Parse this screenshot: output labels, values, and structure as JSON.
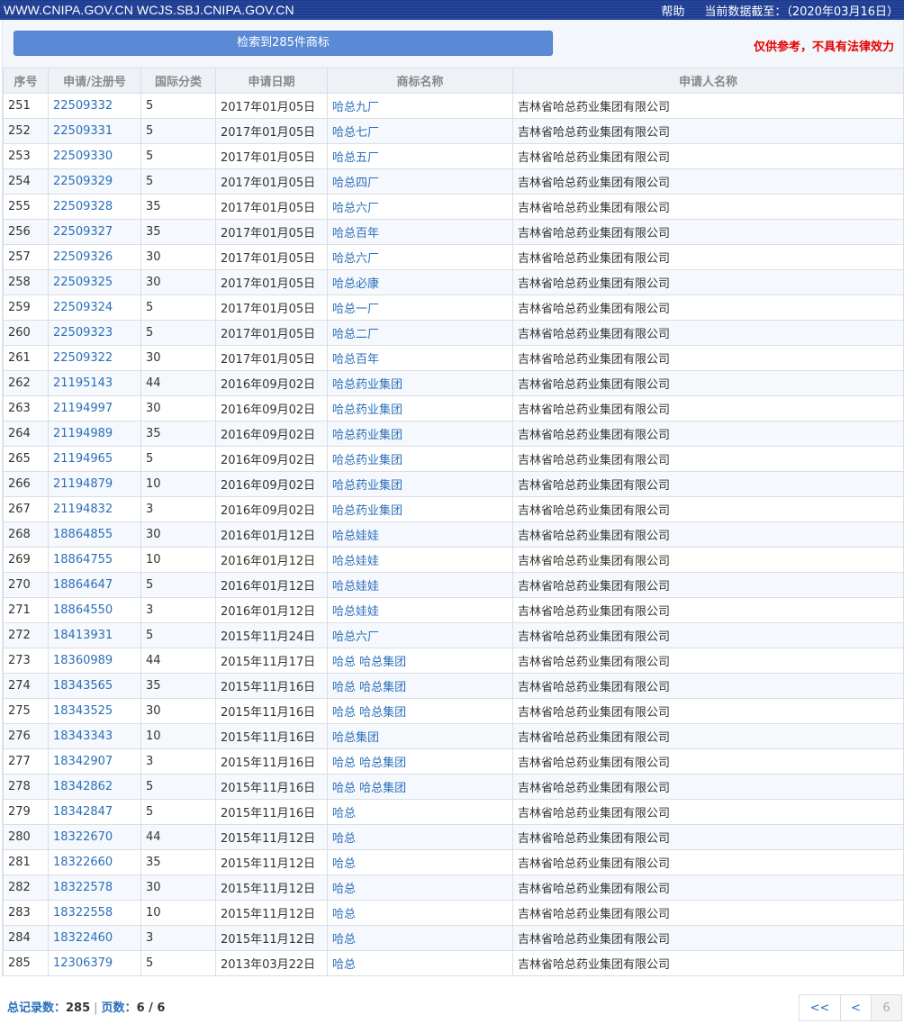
{
  "header": {
    "site": "WWW.CNIPA.GOV.CN WCJS.SBJ.CNIPA.GOV.CN",
    "help": "帮助",
    "data_date": "当前数据截至：（2020年03月16日）"
  },
  "summary": {
    "search_result": "检索到285件商标",
    "disclaimer": "仅供参考，不具有法律效力"
  },
  "table": {
    "headers": [
      "序号",
      "申请/注册号",
      "国际分类",
      "申请日期",
      "商标名称",
      "申请人名称"
    ],
    "rows": [
      [
        "251",
        "22509332",
        "5",
        "2017年01月05日",
        "哈总九厂",
        "吉林省哈总药业集团有限公司"
      ],
      [
        "252",
        "22509331",
        "5",
        "2017年01月05日",
        "哈总七厂",
        "吉林省哈总药业集团有限公司"
      ],
      [
        "253",
        "22509330",
        "5",
        "2017年01月05日",
        "哈总五厂",
        "吉林省哈总药业集团有限公司"
      ],
      [
        "254",
        "22509329",
        "5",
        "2017年01月05日",
        "哈总四厂",
        "吉林省哈总药业集团有限公司"
      ],
      [
        "255",
        "22509328",
        "35",
        "2017年01月05日",
        "哈总六厂",
        "吉林省哈总药业集团有限公司"
      ],
      [
        "256",
        "22509327",
        "35",
        "2017年01月05日",
        "哈总百年",
        "吉林省哈总药业集团有限公司"
      ],
      [
        "257",
        "22509326",
        "30",
        "2017年01月05日",
        "哈总六厂",
        "吉林省哈总药业集团有限公司"
      ],
      [
        "258",
        "22509325",
        "30",
        "2017年01月05日",
        "哈总必康",
        "吉林省哈总药业集团有限公司"
      ],
      [
        "259",
        "22509324",
        "5",
        "2017年01月05日",
        "哈总一厂",
        "吉林省哈总药业集团有限公司"
      ],
      [
        "260",
        "22509323",
        "5",
        "2017年01月05日",
        "哈总二厂",
        "吉林省哈总药业集团有限公司"
      ],
      [
        "261",
        "22509322",
        "30",
        "2017年01月05日",
        "哈总百年",
        "吉林省哈总药业集团有限公司"
      ],
      [
        "262",
        "21195143",
        "44",
        "2016年09月02日",
        "哈总药业集团",
        "吉林省哈总药业集团有限公司"
      ],
      [
        "263",
        "21194997",
        "30",
        "2016年09月02日",
        "哈总药业集团",
        "吉林省哈总药业集团有限公司"
      ],
      [
        "264",
        "21194989",
        "35",
        "2016年09月02日",
        "哈总药业集团",
        "吉林省哈总药业集团有限公司"
      ],
      [
        "265",
        "21194965",
        "5",
        "2016年09月02日",
        "哈总药业集团",
        "吉林省哈总药业集团有限公司"
      ],
      [
        "266",
        "21194879",
        "10",
        "2016年09月02日",
        "哈总药业集团",
        "吉林省哈总药业集团有限公司"
      ],
      [
        "267",
        "21194832",
        "3",
        "2016年09月02日",
        "哈总药业集团",
        "吉林省哈总药业集团有限公司"
      ],
      [
        "268",
        "18864855",
        "30",
        "2016年01月12日",
        "哈总娃娃",
        "吉林省哈总药业集团有限公司"
      ],
      [
        "269",
        "18864755",
        "10",
        "2016年01月12日",
        "哈总娃娃",
        "吉林省哈总药业集团有限公司"
      ],
      [
        "270",
        "18864647",
        "5",
        "2016年01月12日",
        "哈总娃娃",
        "吉林省哈总药业集团有限公司"
      ],
      [
        "271",
        "18864550",
        "3",
        "2016年01月12日",
        "哈总娃娃",
        "吉林省哈总药业集团有限公司"
      ],
      [
        "272",
        "18413931",
        "5",
        "2015年11月24日",
        "哈总六厂",
        "吉林省哈总药业集团有限公司"
      ],
      [
        "273",
        "18360989",
        "44",
        "2015年11月17日",
        "哈总 哈总集团",
        "吉林省哈总药业集团有限公司"
      ],
      [
        "274",
        "18343565",
        "35",
        "2015年11月16日",
        "哈总 哈总集团",
        "吉林省哈总药业集团有限公司"
      ],
      [
        "275",
        "18343525",
        "30",
        "2015年11月16日",
        "哈总 哈总集团",
        "吉林省哈总药业集团有限公司"
      ],
      [
        "276",
        "18343343",
        "10",
        "2015年11月16日",
        "哈总集团",
        "吉林省哈总药业集团有限公司"
      ],
      [
        "277",
        "18342907",
        "3",
        "2015年11月16日",
        "哈总 哈总集团",
        "吉林省哈总药业集团有限公司"
      ],
      [
        "278",
        "18342862",
        "5",
        "2015年11月16日",
        "哈总 哈总集团",
        "吉林省哈总药业集团有限公司"
      ],
      [
        "279",
        "18342847",
        "5",
        "2015年11月16日",
        "哈总",
        "吉林省哈总药业集团有限公司"
      ],
      [
        "280",
        "18322670",
        "44",
        "2015年11月12日",
        "哈总",
        "吉林省哈总药业集团有限公司"
      ],
      [
        "281",
        "18322660",
        "35",
        "2015年11月12日",
        "哈总",
        "吉林省哈总药业集团有限公司"
      ],
      [
        "282",
        "18322578",
        "30",
        "2015年11月12日",
        "哈总",
        "吉林省哈总药业集团有限公司"
      ],
      [
        "283",
        "18322558",
        "10",
        "2015年11月12日",
        "哈总",
        "吉林省哈总药业集团有限公司"
      ],
      [
        "284",
        "18322460",
        "3",
        "2015年11月12日",
        "哈总",
        "吉林省哈总药业集团有限公司"
      ],
      [
        "285",
        "12306379",
        "5",
        "2013年03月22日",
        "哈总",
        "吉林省哈总药业集团有限公司"
      ]
    ]
  },
  "footer": {
    "total_label": "总记录数：",
    "total_value": "285",
    "separator": "|",
    "pages_label": "页数：",
    "pages_value": "6 / 6"
  },
  "pager": {
    "first": "<<",
    "prev": "<",
    "current": "6"
  }
}
